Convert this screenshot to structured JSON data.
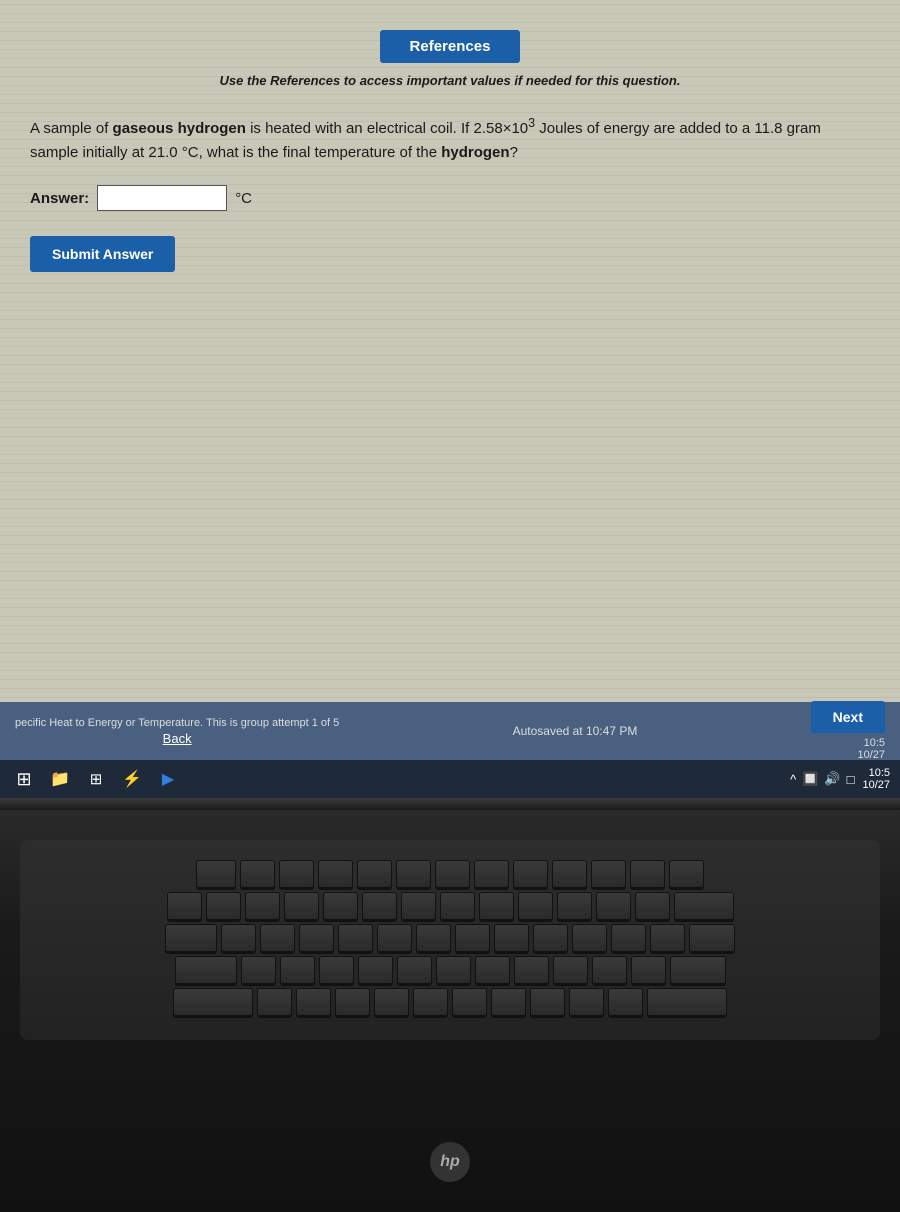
{
  "references_button": {
    "label": "References"
  },
  "subtitle": {
    "text": "Use the References to access important values if needed for this question."
  },
  "question": {
    "part1": "A sample of ",
    "bold1": "gaseous hydrogen",
    "part2": " is heated with an electrical coil. If 2.58×10",
    "superscript": "3",
    "part3": " Joules of energy are added to",
    "part4": "a 11.8 gram sample initially at 21.0 °C, what is the final temperature of the ",
    "bold2": "hydrogen",
    "part5": "?"
  },
  "answer": {
    "label": "Answer:",
    "placeholder": "",
    "unit": "°C"
  },
  "submit_button": {
    "label": "Submit Answer"
  },
  "bottom_bar": {
    "group_attempt_text": "pecific Heat to Energy or Temperature. This is group attempt 1 of 5",
    "autosave_text": "Autosaved at 10:47 PM",
    "back_label": "Back",
    "next_label": "Next",
    "time": "10:5",
    "date": "10/27"
  },
  "taskbar": {
    "time": "10:5",
    "date": "10/27"
  },
  "hp_logo": "hp"
}
